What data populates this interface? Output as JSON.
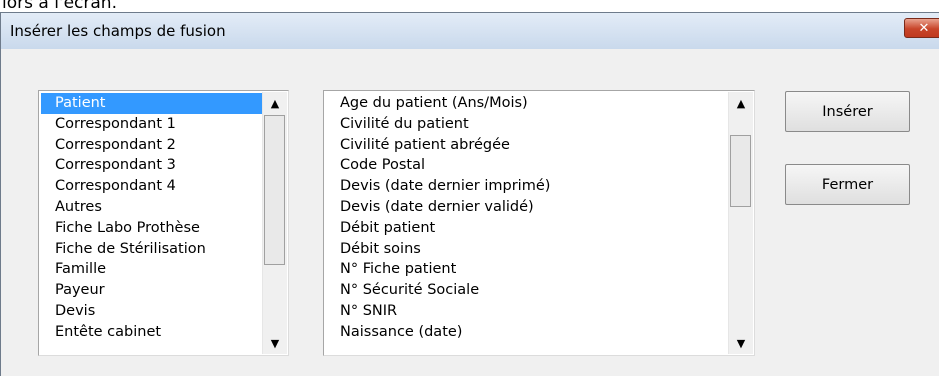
{
  "caption": "lors à l'écran.",
  "window": {
    "title": "Insérer les champs de fusion",
    "close_label": "✕"
  },
  "categories": {
    "items": [
      {
        "label": "Patient",
        "selected": true
      },
      {
        "label": "Correspondant 1"
      },
      {
        "label": "Correspondant 2"
      },
      {
        "label": "Correspondant 3"
      },
      {
        "label": "Correspondant 4"
      },
      {
        "label": "Autres"
      },
      {
        "label": "Fiche Labo Prothèse"
      },
      {
        "label": "Fiche de Stérilisation"
      },
      {
        "label": "Famille"
      },
      {
        "label": "Payeur"
      },
      {
        "label": "Devis"
      },
      {
        "label": "Entête cabinet"
      }
    ]
  },
  "fields": {
    "items": [
      {
        "label": "Age du patient (Ans/Mois)"
      },
      {
        "label": "Civilité du patient"
      },
      {
        "label": "Civilité patient abrégée"
      },
      {
        "label": "Code Postal"
      },
      {
        "label": "Devis (date dernier imprimé)"
      },
      {
        "label": "Devis (date dernier validé)"
      },
      {
        "label": "Débit patient"
      },
      {
        "label": "Débit soins"
      },
      {
        "label": "N° Fiche patient"
      },
      {
        "label": "N° Sécurité Sociale"
      },
      {
        "label": "N° SNIR"
      },
      {
        "label": "Naissance (date)"
      }
    ]
  },
  "buttons": {
    "insert_label": "Insérer",
    "close_label": "Fermer"
  },
  "icons": {
    "scroll_up": "▲",
    "scroll_down": "▼"
  },
  "colors": {
    "selection": "#3399ff",
    "close_button": "#c8452a",
    "title_bar": "#d6e3f2"
  }
}
